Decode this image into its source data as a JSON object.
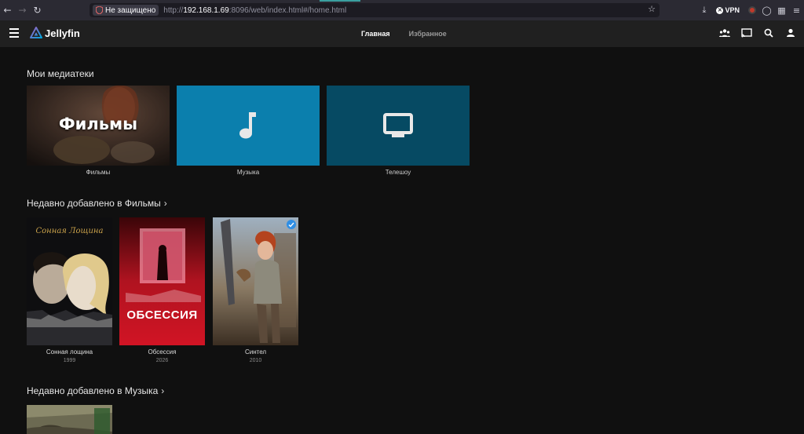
{
  "browser": {
    "security_label": "Не защищено",
    "url_prefix": "http://",
    "url_host": "192.168.1.69",
    "url_rest": ":8096/web/index.html#/home.html",
    "vpn_label": "VPN"
  },
  "app": {
    "logo_text": "Jellyfin",
    "tabs": [
      {
        "label": "Главная",
        "active": true
      },
      {
        "label": "Избранное",
        "active": false
      }
    ]
  },
  "libraries": {
    "title": "Мои медиатеки",
    "items": [
      {
        "label": "Фильмы",
        "overlay_text": "Фильмы"
      },
      {
        "label": "Музыка",
        "icon": "music-note-icon"
      },
      {
        "label": "Телешоу",
        "icon": "tv-icon"
      }
    ]
  },
  "recent_movies": {
    "title": "Недавно добавлено в Фильмы",
    "items": [
      {
        "title": "Сонная лощина",
        "year": "1999",
        "poster_text": "Сонная Лощина"
      },
      {
        "title": "Обсессия",
        "year": "2026",
        "poster_text": "ОБСЕССИЯ"
      },
      {
        "title": "Синтел",
        "year": "2010",
        "watched": true
      }
    ]
  },
  "recent_music": {
    "title": "Недавно добавлено в Музыка"
  },
  "colors": {
    "accent": "#00a4dc",
    "music_tile": "#0b7fad",
    "tv_tile": "#064a63",
    "background": "#101010",
    "header": "#202020"
  }
}
